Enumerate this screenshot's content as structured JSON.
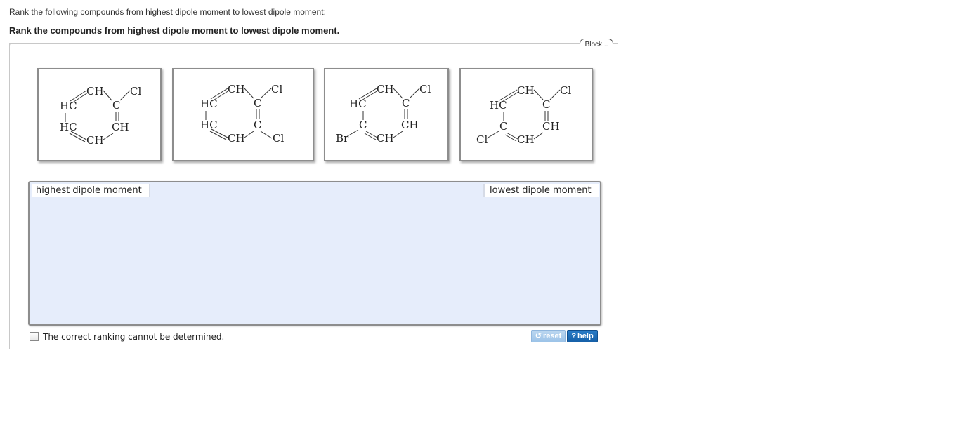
{
  "question": {
    "intro": "Rank the following compounds from highest dipole moment to lowest dipole moment:",
    "instruction": "Rank the compounds from highest dipole moment to lowest dipole moment."
  },
  "toolbar": {
    "block_label": "Block..."
  },
  "tiles": [
    {
      "labels": [
        "CH",
        "Cl",
        "HC",
        "C",
        "HC",
        "CH",
        "CH"
      ]
    },
    {
      "labels": [
        "CH",
        "Cl",
        "HC",
        "C",
        "HC",
        "C",
        "CH",
        "Cl"
      ]
    },
    {
      "labels": [
        "CH",
        "Cl",
        "HC",
        "C",
        "C",
        "CH",
        "Br",
        "CH"
      ]
    },
    {
      "labels": [
        "CH",
        "Cl",
        "HC",
        "C",
        "C",
        "CH",
        "Cl",
        "CH"
      ]
    }
  ],
  "dropzone": {
    "highest_label": "highest dipole moment",
    "lowest_label": "lowest dipole moment"
  },
  "checkbox": {
    "label": "The correct ranking cannot be determined.",
    "checked": false
  },
  "buttons": {
    "reset_label": "reset",
    "help_label": "help"
  },
  "colors": {
    "dropzone_bg": "#e6edfb",
    "help_button": "#1560a8",
    "reset_button": "#9cc3e8"
  }
}
